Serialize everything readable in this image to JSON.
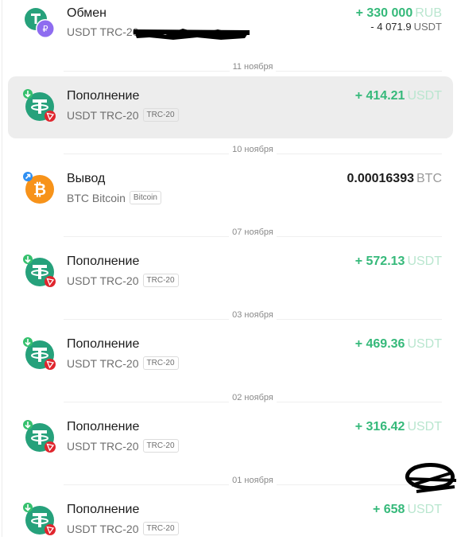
{
  "colors": {
    "positive": "#35b97a",
    "positive_currency": "#b9e6cf",
    "tether": "#26a17b",
    "tron": "#e0262e",
    "bitcoin": "#f7931a",
    "ruble": "#8e6cf0",
    "arrow_in": "#35c06d",
    "arrow_out": "#2f8ff2",
    "selected_bg": "#ededed"
  },
  "transactions": [
    {
      "title": "Обмен",
      "asset": "USDT TRC-20",
      "chip": "",
      "amount": "+ 330 000",
      "currency": "RUB",
      "amount2": "- 4 071.9",
      "currency2": "USDT",
      "icon": "exchange-usdt-rub-icon"
    },
    {
      "date": "11 ноября",
      "title": "Пополнение",
      "asset": "USDT TRC-20",
      "chip": "TRC-20",
      "amount": "+ 414.21",
      "currency": "USDT",
      "icon": "deposit-usdt-icon",
      "selected": true
    },
    {
      "date": "10 ноября",
      "title": "Вывод",
      "asset": "BTC Bitcoin",
      "chip": "Bitcoin",
      "amount": "0.00016393",
      "currency": "BTC",
      "icon": "withdraw-btc-icon"
    },
    {
      "date": "07 ноября",
      "title": "Пополнение",
      "asset": "USDT TRC-20",
      "chip": "TRC-20",
      "amount": "+ 572.13",
      "currency": "USDT",
      "icon": "deposit-usdt-icon"
    },
    {
      "date": "03 ноября",
      "title": "Пополнение",
      "asset": "USDT TRC-20",
      "chip": "TRC-20",
      "amount": "+ 469.36",
      "currency": "USDT",
      "icon": "deposit-usdt-icon"
    },
    {
      "date": "02 ноября",
      "title": "Пополнение",
      "asset": "USDT TRC-20",
      "chip": "TRC-20",
      "amount": "+ 316.42",
      "currency": "USDT",
      "icon": "deposit-usdt-icon"
    },
    {
      "date": "01 ноября",
      "title": "Пополнение",
      "asset": "USDT TRC-20",
      "chip": "TRC-20",
      "amount": "+ 658",
      "currency": "USDT",
      "icon": "deposit-usdt-icon"
    }
  ]
}
